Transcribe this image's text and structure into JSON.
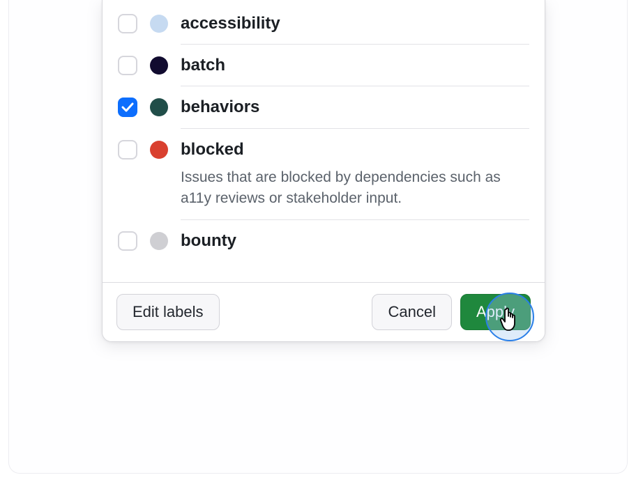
{
  "labels": [
    {
      "name": "accessibility",
      "checked": false,
      "color": "#c6daf1",
      "description": null
    },
    {
      "name": "batch",
      "checked": false,
      "color": "#110b2f",
      "description": null
    },
    {
      "name": "behaviors",
      "checked": true,
      "color": "#214e49",
      "description": null
    },
    {
      "name": "blocked",
      "checked": false,
      "color": "#d9402f",
      "description": "Issues that are blocked by dependencies such as a11y reviews or stakeholder input."
    },
    {
      "name": "bounty",
      "checked": false,
      "color": "#cfcfd3",
      "description": null
    }
  ],
  "footer": {
    "edit_labels": "Edit labels",
    "cancel": "Cancel",
    "apply": "Apply"
  }
}
